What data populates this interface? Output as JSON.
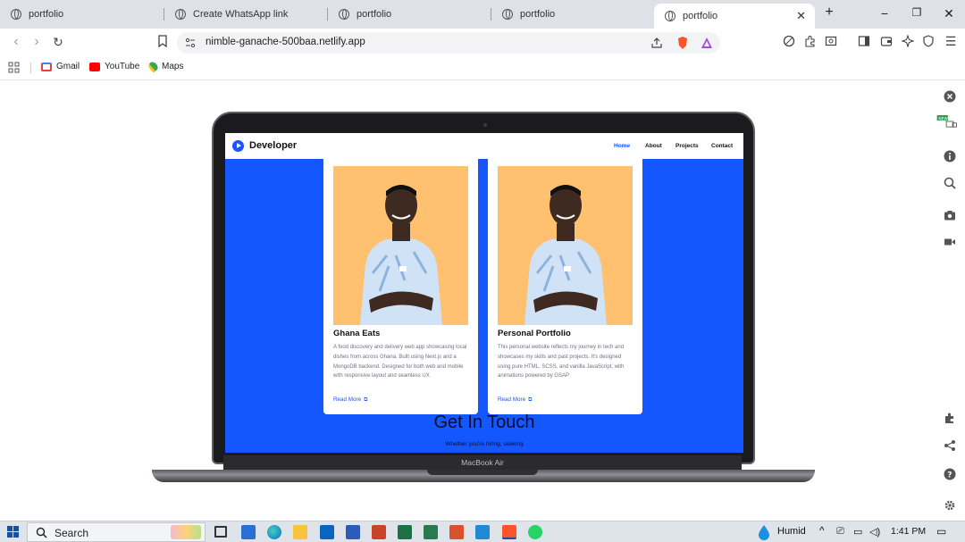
{
  "browser": {
    "tabs": [
      {
        "title": "portfolio",
        "active": false
      },
      {
        "title": "Create WhatsApp link",
        "active": false
      },
      {
        "title": "portfolio",
        "active": false
      },
      {
        "title": "portfolio",
        "active": false
      },
      {
        "title": "portfolio",
        "active": true
      }
    ],
    "new_tab": "+",
    "url": "nimble-ganache-500baa.netlify.app",
    "bookmarks": [
      {
        "label": "Gmail",
        "color": "#ea4335"
      },
      {
        "label": "YouTube",
        "color": "#ff0000"
      },
      {
        "label": "Maps",
        "color": "#34a853"
      }
    ]
  },
  "site": {
    "brand": "Developer",
    "nav": [
      "Home",
      "About",
      "Projects",
      "Contact"
    ],
    "accent": "#1a56ff",
    "projects": [
      {
        "title": "Ghana Eats",
        "description": "A food discovery and delivery web app showcasing local dishes from across Ghana. Built using Next.js and a MongoDB backend. Designed for both web and mobile with responsive layout and seamless UX",
        "link": "Read More"
      },
      {
        "title": "Personal Portfolio",
        "description": "This personal website reflects my journey in tech and showcases my skills and past projects. It's designed using pure HTML, SCSS, and vanilla JavaScript, with animations powered by GSAP",
        "link": "Read More"
      }
    ],
    "contact": {
      "title": "Get In Touch",
      "subtitle": "Whether you're hiring, seeking"
    }
  },
  "device": {
    "label": "MacBook Air"
  },
  "taskbar": {
    "search": "Search",
    "weather": "Humid",
    "time": "1:41 PM"
  }
}
